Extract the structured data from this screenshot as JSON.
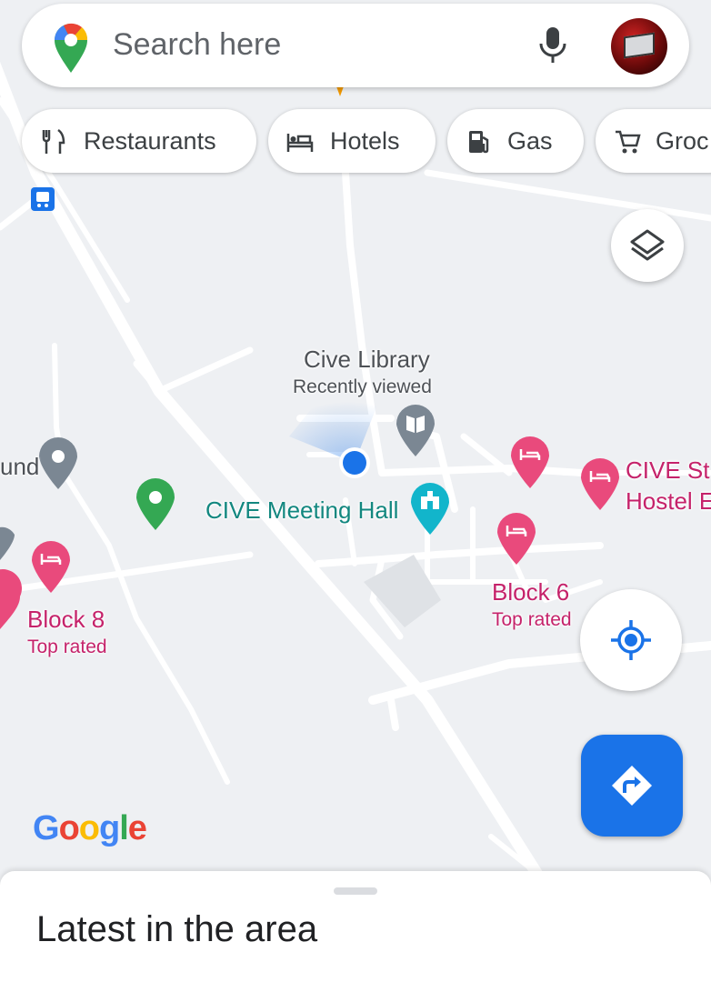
{
  "search": {
    "placeholder": "Search here"
  },
  "chips": [
    {
      "label": "Restaurants",
      "icon": "restaurant-icon"
    },
    {
      "label": "Hotels",
      "icon": "hotel-icon"
    },
    {
      "label": "Gas",
      "icon": "gas-station-icon"
    },
    {
      "label": "Groc",
      "icon": "grocery-cart-icon"
    }
  ],
  "map": {
    "places": {
      "cive_library": {
        "name": "Cive Library",
        "note": "Recently viewed",
        "icon": "library-pin-icon"
      },
      "cive_meeting_hall": {
        "name": "CIVE Meeting Hall",
        "icon": "landmark-pin-icon"
      },
      "hostel": {
        "name_line1": "CIVE St",
        "name_line2": "Hostel E",
        "icon": "hotel-pin-icon"
      },
      "block6": {
        "name": "Block 6",
        "note": "Top rated",
        "icon": "hotel-pin-icon"
      },
      "block8": {
        "name": "Block 8",
        "note": "Top rated",
        "icon": "hotel-pin-icon"
      },
      "left_partial": {
        "name": "und",
        "icon": "place-pin-icon"
      }
    },
    "colors": {
      "background": "#eef0f3",
      "road": "#ffffff",
      "hotel_pin": "#e94a7c",
      "landmark_pin": "#12b5cb",
      "place_pin": "#7b8793",
      "green_pin": "#34a853",
      "location_dot": "#1a73e8"
    }
  },
  "controls": {
    "layers": "layers-icon",
    "my_location": "my-location-icon",
    "directions": "directions-icon"
  },
  "branding": {
    "logo_text": "Google"
  },
  "bottom_sheet": {
    "title": "Latest in the area"
  }
}
